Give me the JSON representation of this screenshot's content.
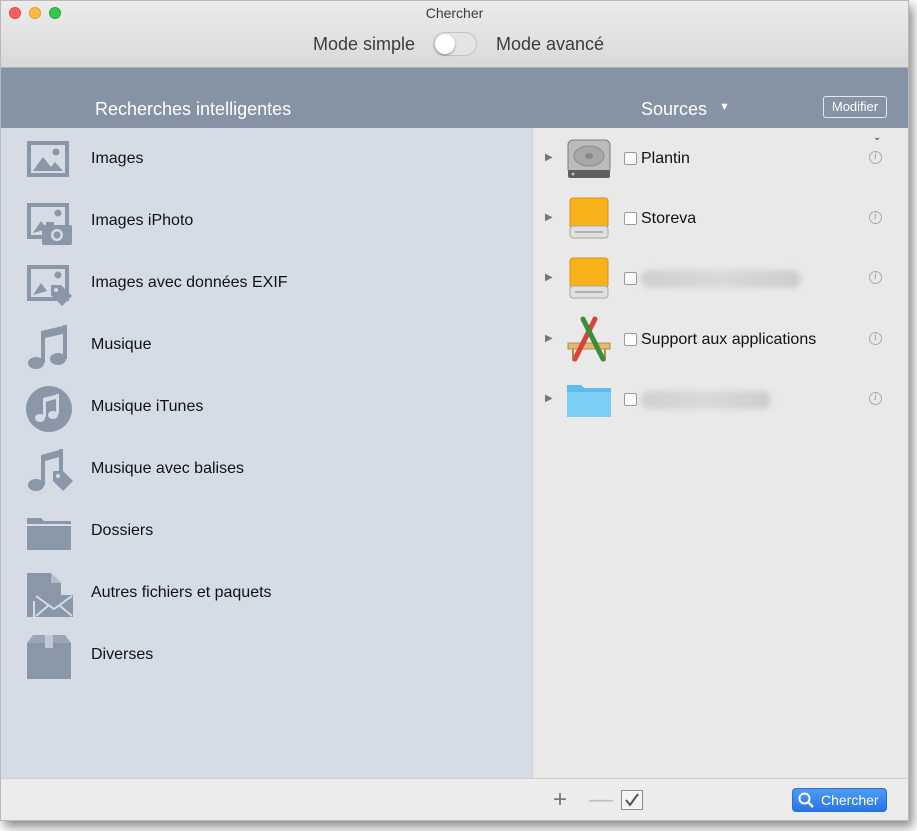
{
  "window": {
    "title": "Chercher"
  },
  "mode": {
    "simple_label": "Mode simple",
    "advanced_label": "Mode avancé",
    "advanced_on": false
  },
  "header": {
    "left_title": "Recherches intelligentes",
    "sources_label": "Sources",
    "modify_label": "Modifier"
  },
  "smart_searches": [
    {
      "label": "Images",
      "icon": "image-icon"
    },
    {
      "label": "Images iPhoto",
      "icon": "photo-camera-icon"
    },
    {
      "label": "Images avec données EXIF",
      "icon": "image-tag-icon"
    },
    {
      "label": "Musique",
      "icon": "music-note-icon"
    },
    {
      "label": "Musique iTunes",
      "icon": "itunes-icon"
    },
    {
      "label": "Musique avec balises",
      "icon": "music-tag-icon"
    },
    {
      "label": "Dossiers",
      "icon": "folder-icon"
    },
    {
      "label": "Autres fichiers et paquets",
      "icon": "file-envelope-icon"
    },
    {
      "label": "Diverses",
      "icon": "box-icon"
    }
  ],
  "sources": [
    {
      "name": "Plantin",
      "icon": "hard-drive-icon",
      "blurred": false,
      "checked": false
    },
    {
      "name": "Storeva",
      "icon": "external-drive-icon",
      "blurred": false,
      "checked": false
    },
    {
      "name": "",
      "icon": "external-drive-icon",
      "blurred": true,
      "checked": false
    },
    {
      "name": "Support aux applications",
      "icon": "applications-icon",
      "blurred": false,
      "checked": false
    },
    {
      "name": "",
      "icon": "blue-folder-icon",
      "blurred": true,
      "checked": false
    }
  ],
  "bottom": {
    "search_label": "Chercher"
  },
  "colors": {
    "header": "#8693a4",
    "left_panel": "#d5dce6",
    "icon": "#8a97a8",
    "accent": "#2774e8"
  }
}
